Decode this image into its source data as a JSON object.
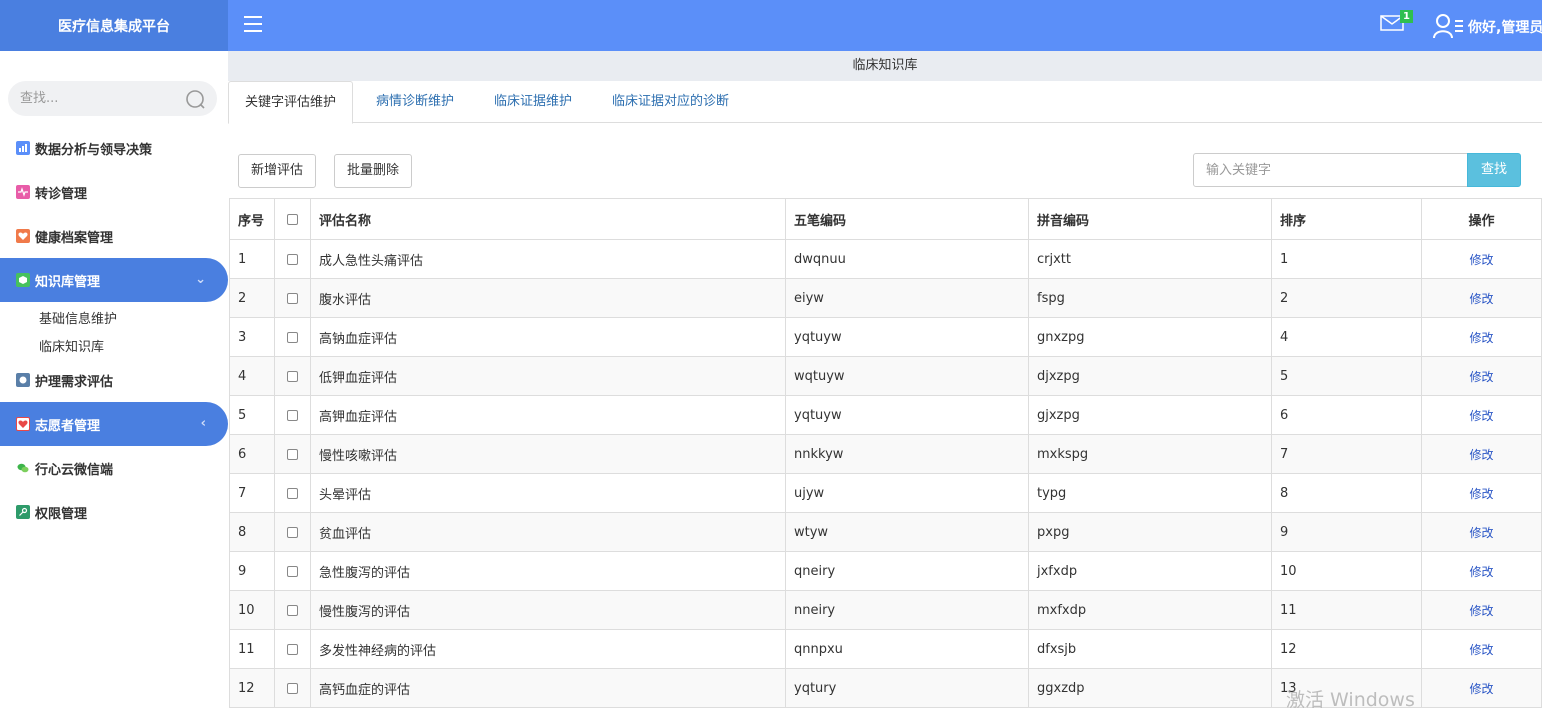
{
  "app": {
    "title": "医疗信息集成平台",
    "greeting": "你好,管理员",
    "mail_count": "1"
  },
  "sidebar": {
    "search_placeholder": "查找...",
    "items": [
      {
        "label": "数据分析与领导决策",
        "icon": "chart-icon",
        "color": "#5b8ff9"
      },
      {
        "label": "转诊管理",
        "icon": "pulse-icon",
        "color": "#e85ca8"
      },
      {
        "label": "健康档案管理",
        "icon": "heart-icon",
        "color": "#f07a4a"
      },
      {
        "label": "知识库管理",
        "icon": "cube-icon",
        "color": "#46c15e"
      },
      {
        "label": "护理需求评估",
        "icon": "shield-icon",
        "color": "#5a7fa8"
      },
      {
        "label": "志愿者管理",
        "icon": "heart-check-icon",
        "color": "#e84848"
      },
      {
        "label": "行心云微信端",
        "icon": "wechat-icon",
        "color": "#3cb44a"
      },
      {
        "label": "权限管理",
        "icon": "key-icon",
        "color": "#2e9b6a"
      }
    ],
    "sub_items": [
      {
        "label": "基础信息维护"
      },
      {
        "label": "临床知识库"
      }
    ]
  },
  "breadcrumb": "临床知识库",
  "tabs": [
    {
      "label": "关键字评估维护"
    },
    {
      "label": "病情诊断维护"
    },
    {
      "label": "临床证据维护"
    },
    {
      "label": "临床证据对应的诊断"
    }
  ],
  "toolbar": {
    "add_label": "新增评估",
    "batch_delete_label": "批量删除",
    "keyword_placeholder": "输入关键字",
    "search_label": "查找"
  },
  "table": {
    "columns": [
      "序号",
      "评估名称",
      "五笔编码",
      "拼音编码",
      "排序",
      "操作"
    ],
    "rows": [
      {
        "no": "1",
        "name": "成人急性头痛评估",
        "wubi": "dwqnuu",
        "pinyin": "crjxtt",
        "sort": "1",
        "action": "修改"
      },
      {
        "no": "2",
        "name": "腹水评估",
        "wubi": "eiyw",
        "pinyin": "fspg",
        "sort": "2",
        "action": "修改"
      },
      {
        "no": "3",
        "name": "高钠血症评估",
        "wubi": "yqtuyw",
        "pinyin": "gnxzpg",
        "sort": "4",
        "action": "修改"
      },
      {
        "no": "4",
        "name": "低钾血症评估",
        "wubi": "wqtuyw",
        "pinyin": "djxzpg",
        "sort": "5",
        "action": "修改"
      },
      {
        "no": "5",
        "name": "高钾血症评估",
        "wubi": "yqtuyw",
        "pinyin": "gjxzpg",
        "sort": "6",
        "action": "修改"
      },
      {
        "no": "6",
        "name": "慢性咳嗽评估",
        "wubi": "nnkkyw",
        "pinyin": "mxkspg",
        "sort": "7",
        "action": "修改"
      },
      {
        "no": "7",
        "name": "头晕评估",
        "wubi": "ujyw",
        "pinyin": "typg",
        "sort": "8",
        "action": "修改"
      },
      {
        "no": "8",
        "name": "贫血评估",
        "wubi": "wtyw",
        "pinyin": "pxpg",
        "sort": "9",
        "action": "修改"
      },
      {
        "no": "9",
        "name": "急性腹泻的评估",
        "wubi": "qneiry",
        "pinyin": "jxfxdp",
        "sort": "10",
        "action": "修改"
      },
      {
        "no": "10",
        "name": "慢性腹泻的评估",
        "wubi": "nneiry",
        "pinyin": "mxfxdp",
        "sort": "11",
        "action": "修改"
      },
      {
        "no": "11",
        "name": "多发性神经病的评估",
        "wubi": "qnnpxu",
        "pinyin": "dfxsjb",
        "sort": "12",
        "action": "修改"
      },
      {
        "no": "12",
        "name": "高钙血症的评估",
        "wubi": "yqtury",
        "pinyin": "ggxzdp",
        "sort": "13",
        "action": "修改"
      }
    ]
  },
  "watermark": "激活 Windows",
  "colors": {
    "primary": "#4a7fe0",
    "topbar": "#5b8ff9",
    "search_button": "#5bc0de",
    "link": "#2a56c6"
  }
}
